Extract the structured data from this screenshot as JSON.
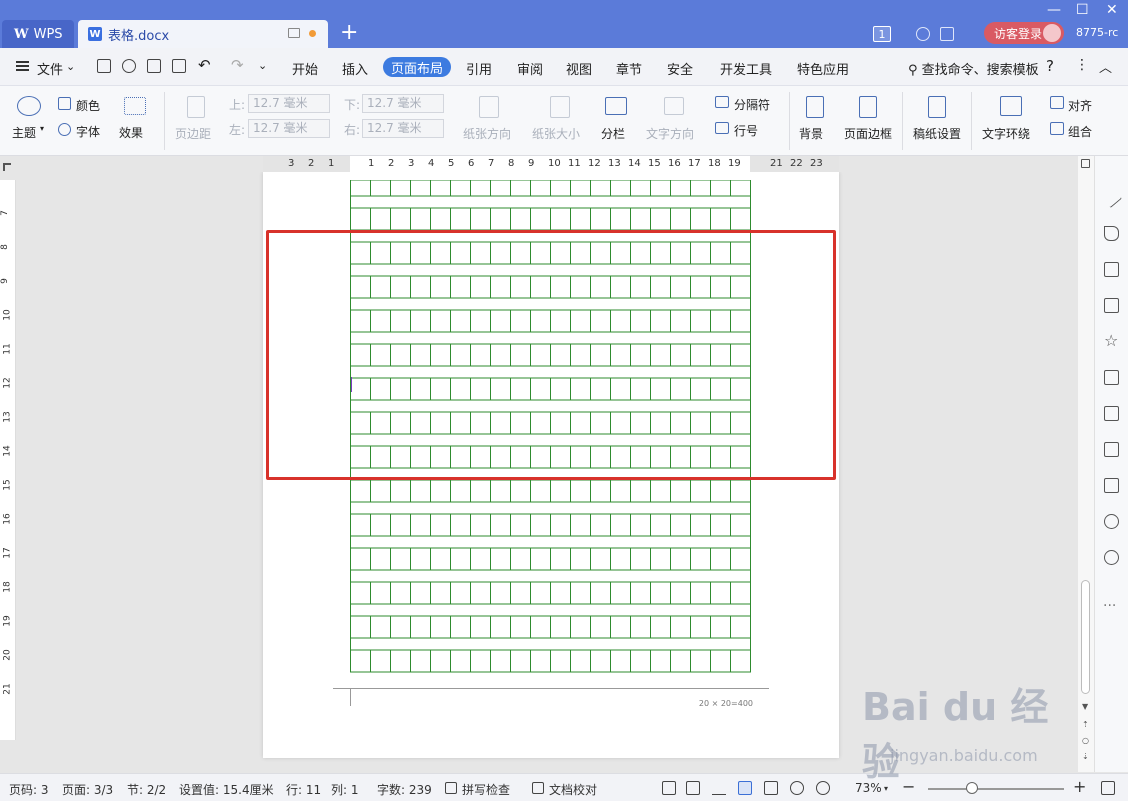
{
  "titlebar": {
    "app_tab": "WPS",
    "doc_tab": "表格.docx",
    "add_tab": "+",
    "badge": "1",
    "login": "访客登录",
    "user_id": "8775-rc"
  },
  "menu": {
    "file": "文件",
    "items": [
      "开始",
      "插入",
      "页面布局",
      "引用",
      "审阅",
      "视图",
      "章节",
      "安全",
      "开发工具",
      "特色应用"
    ],
    "active": "页面布局",
    "search": "查找命令、搜索模板",
    "help": "?"
  },
  "ribbon": {
    "theme": "主题",
    "color": "颜色",
    "font": "字体",
    "effect": "效果",
    "margin": "页边距",
    "top_label": "上:",
    "top_value": "12.7 毫米",
    "bottom_label": "下:",
    "bottom_value": "12.7 毫米",
    "left_label": "左:",
    "left_value": "12.7 毫米",
    "right_label": "右:",
    "right_value": "12.7 毫米",
    "orientation": "纸张方向",
    "size": "纸张大小",
    "columns": "分栏",
    "text_direction": "文字方向",
    "breaks": "分隔符",
    "line_numbers": "行号",
    "background": "背景",
    "page_border": "页面边框",
    "grid_paper": "稿纸设置",
    "wrap": "文字环绕",
    "align": "对齐",
    "group": "组合"
  },
  "ruler": {
    "h_labels": [
      "3",
      "2",
      "1",
      "1",
      "2",
      "3",
      "4",
      "5",
      "6",
      "7",
      "8",
      "9",
      "10",
      "11",
      "12",
      "13",
      "14",
      "15",
      "16",
      "17",
      "18",
      "19",
      "21",
      "22",
      "23"
    ],
    "v_labels": [
      "7",
      "8",
      "9",
      "10",
      "11",
      "12",
      "13",
      "14",
      "15",
      "16",
      "17",
      "18",
      "19",
      "20",
      "21"
    ]
  },
  "document": {
    "grid_caption": "20 × 20=400",
    "grid_color": "#2e8b2e",
    "highlight_color": "#d8322b",
    "columns": 20,
    "rows_visible": 15
  },
  "status": {
    "page_no": "页码: 3",
    "pages": "页面: 3/3",
    "section": "节: 2/2",
    "setting": "设置值: 15.4厘米",
    "row": "行: 11",
    "col": "列: 1",
    "words": "字数: 239",
    "spell": "拼写检查",
    "proof": "文档校对",
    "zoom": "73%",
    "minus": "−",
    "plus": "+"
  },
  "watermark": {
    "brand": "Bai du 经验",
    "url": "jingyan.baidu.com"
  }
}
